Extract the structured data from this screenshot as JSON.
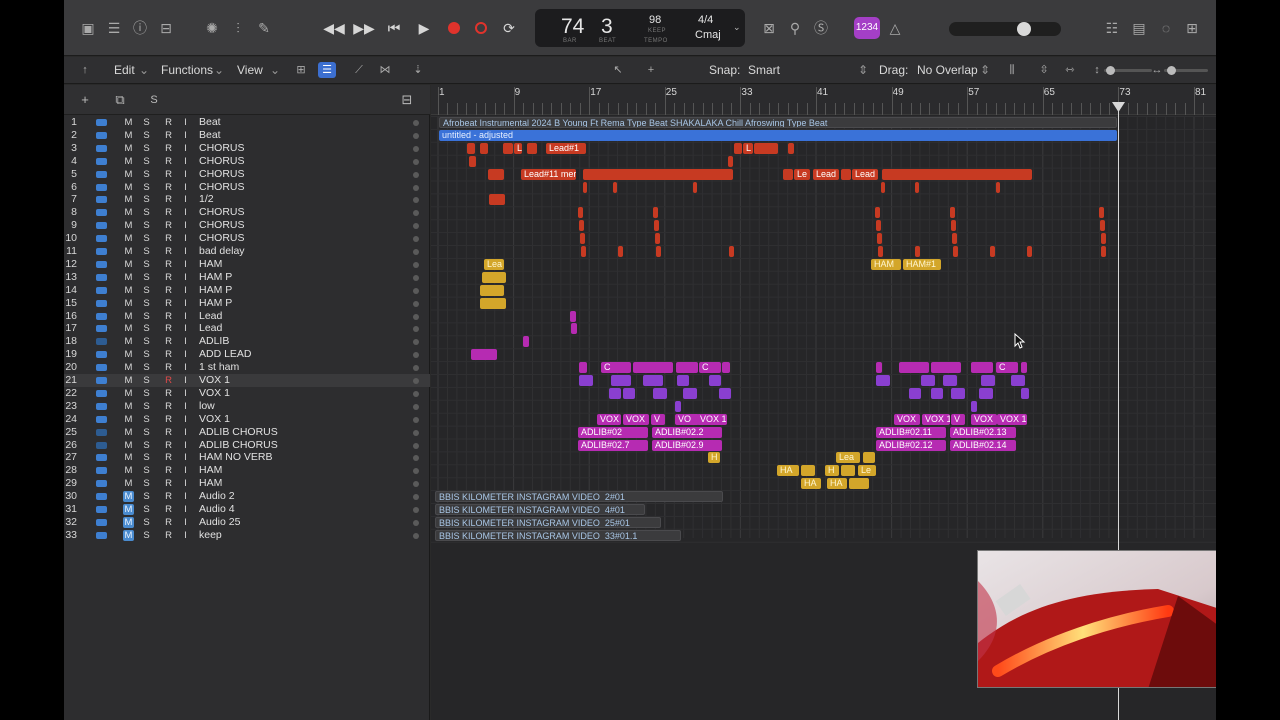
{
  "lcd": {
    "bar": "74",
    "beat": "3",
    "bar_label": "BAR",
    "beat_label": "BEAT",
    "tempo": "98",
    "tempo_mode": "KEEP",
    "tempo_label": "TEMPO",
    "time_signature": "4/4",
    "key": "Cmaj"
  },
  "control_bar": {
    "count_in_label": "1234"
  },
  "toolbar": {
    "edit_label": "Edit",
    "functions_label": "Functions",
    "view_label": "View",
    "snap_label": "Snap:",
    "snap_value": "Smart",
    "drag_label": "Drag:",
    "drag_value": "No Overlap"
  },
  "header": {
    "add_label": "+",
    "s_label": "S"
  },
  "ruler": {
    "bars": [
      "1",
      "9",
      "17",
      "25",
      "33",
      "41",
      "49",
      "57",
      "65",
      "73",
      "81"
    ]
  },
  "track_button_labels": {
    "m": "M",
    "s": "S",
    "r": "R",
    "i": "I"
  },
  "tracks": [
    {
      "num": "1",
      "name": "Beat"
    },
    {
      "num": "2",
      "name": "Beat"
    },
    {
      "num": "3",
      "name": "CHORUS"
    },
    {
      "num": "4",
      "name": "CHORUS"
    },
    {
      "num": "5",
      "name": "CHORUS"
    },
    {
      "num": "6",
      "name": "CHORUS"
    },
    {
      "num": "7",
      "name": "1/2"
    },
    {
      "num": "8",
      "name": "CHORUS"
    },
    {
      "num": "9",
      "name": "CHORUS"
    },
    {
      "num": "10",
      "name": "CHORUS"
    },
    {
      "num": "11",
      "name": "bad delay"
    },
    {
      "num": "12",
      "name": "HAM"
    },
    {
      "num": "13",
      "name": "HAM P"
    },
    {
      "num": "14",
      "name": "HAM P"
    },
    {
      "num": "15",
      "name": "HAM P"
    },
    {
      "num": "16",
      "name": "Lead"
    },
    {
      "num": "17",
      "name": "Lead"
    },
    {
      "num": "18",
      "name": "ADLIB"
    },
    {
      "num": "19",
      "name": "ADD LEAD"
    },
    {
      "num": "20",
      "name": "1 st ham"
    },
    {
      "num": "21",
      "name": "VOX 1"
    },
    {
      "num": "22",
      "name": "VOX 1"
    },
    {
      "num": "23",
      "name": "low"
    },
    {
      "num": "24",
      "name": "VOX 1"
    },
    {
      "num": "25",
      "name": "ADLIB CHORUS"
    },
    {
      "num": "26",
      "name": "ADLIB CHORUS"
    },
    {
      "num": "27",
      "name": "HAM NO VERB"
    },
    {
      "num": "28",
      "name": "HAM"
    },
    {
      "num": "29",
      "name": "HAM"
    },
    {
      "num": "30",
      "name": "Audio 2"
    },
    {
      "num": "31",
      "name": "Audio 4"
    },
    {
      "num": "32",
      "name": "Audio 25"
    },
    {
      "num": "33",
      "name": "keep"
    }
  ],
  "regions": {
    "beat_title": "Afrobeat Instrumental 2024 B Young Ft Rema Type Beat SHAKALAKA Chill Afroswing Type Beat",
    "beat_adjusted": "untitled - adjusted",
    "lead1": "Lead#1",
    "l1": "L",
    "l2": "L",
    "lead11": "Lead#11 mer",
    "le": "Le",
    "lead_a": "Lead",
    "lead_b": "Lead",
    "lea_yellow": "Lea",
    "ham": "HAM",
    "ham1": "HAM#1",
    "c1": "C",
    "c2": "C",
    "c3": "C",
    "vox_a": "VOX",
    "vox_b": "VOX",
    "v_a": "V",
    "vo": "VO",
    "vox1_a": "VOX 1",
    "vox_c": "VOX",
    "vox1_b": "VOX 1",
    "v_b": "V",
    "vox_d": "VOX",
    "vox1_c": "VOX 1",
    "adlib022": "ADLIB#02.2",
    "adlib02": "ADLIB#02",
    "adlib027": "ADLIB#02.7",
    "adlib029": "ADLIB#02.9",
    "adlib0211": "ADLIB#02.11",
    "adlib0213": "ADLIB#02.13",
    "adlib0212": "ADLIB#02.12",
    "adlib0214": "ADLIB#02.14",
    "h": "H",
    "lea2": "Lea",
    "ha1": "HA",
    "h2": "H",
    "le2": "Le",
    "ha2": "HA",
    "ha3": "HA",
    "audio2": "BBIS KILOMETER INSTAGRAM VIDEO_2#01",
    "audio4": "BBIS KILOMETER INSTAGRAM VIDEO_4#01",
    "audio25": "BBIS KILOMETER INSTAGRAM VIDEO_25#01",
    "audio33": "BBIS KILOMETER INSTAGRAM VIDEO_33#01.1"
  },
  "colors": {
    "region_red": "#c73a22",
    "region_yellow": "#d3a62a",
    "region_magenta": "#b62bb2",
    "region_purple": "#8a3fd0",
    "region_blue": "#3a72d8",
    "record": "#e0332c",
    "accent": "#3c6fd0"
  }
}
